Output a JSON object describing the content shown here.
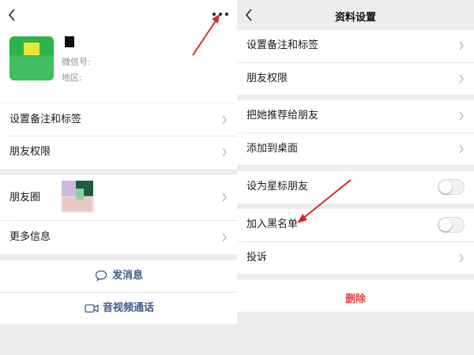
{
  "profile": {
    "wechat_id_label": "微信号:",
    "region_label": "地区:"
  },
  "left_rows": {
    "remark_label": "设置备注和标签",
    "permissions_label": "朋友权限",
    "moments_label": "朋友圈",
    "more_info_label": "更多信息"
  },
  "actions": {
    "message_label": "发消息",
    "call_label": "音视频通话"
  },
  "settings": {
    "title": "资料设置",
    "remark_label": "设置备注和标签",
    "permissions_label": "朋友权限",
    "recommend_label": "把她推荐给朋友",
    "add_desktop_label": "添加到桌面",
    "star_label": "设为星标朋友",
    "blacklist_label": "加入黑名单",
    "report_label": "投诉",
    "delete_label": "删除",
    "star_toggle": "off",
    "blacklist_toggle": "off"
  },
  "icons": {
    "back": "chevron-left-icon",
    "more": "more-dots-icon",
    "chevron": "chevron-right-icon",
    "message": "chat-bubble-icon",
    "call": "video-camera-icon"
  },
  "colors": {
    "link": "#3f5a8a",
    "danger": "#e64340",
    "background": "#ededed",
    "annotation_arrow": "#d42a2a"
  }
}
